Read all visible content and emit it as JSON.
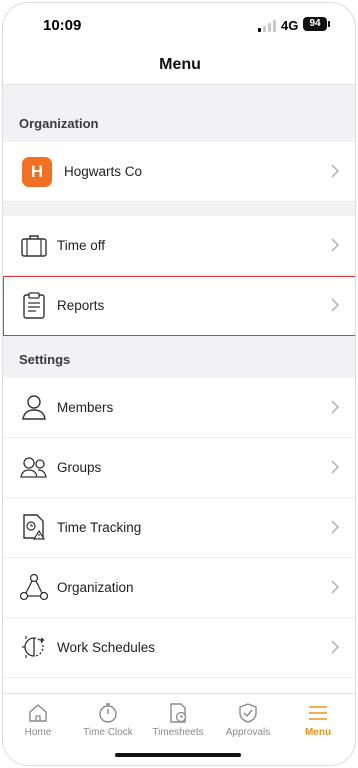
{
  "status_bar": {
    "time": "10:09",
    "network": "4G",
    "battery": "94"
  },
  "header": {
    "title": "Menu"
  },
  "organization_section": {
    "label": "Organization",
    "org": {
      "initial": "H",
      "name": "Hogwarts Co",
      "color": "#f36f21"
    }
  },
  "menu_items": [
    {
      "label": "Time off",
      "icon": "briefcase-icon"
    },
    {
      "label": "Reports",
      "icon": "clipboard-icon",
      "highlighted": true
    }
  ],
  "settings_section": {
    "label": "Settings",
    "items": [
      {
        "label": "Members",
        "icon": "person-icon"
      },
      {
        "label": "Groups",
        "icon": "people-icon"
      },
      {
        "label": "Time Tracking",
        "icon": "time-document-icon"
      },
      {
        "label": "Organization",
        "icon": "network-icon"
      },
      {
        "label": "Work Schedules",
        "icon": "day-night-icon"
      }
    ]
  },
  "tabbar": {
    "accent": "#f0921c",
    "tabs": [
      {
        "label": "Home",
        "icon": "home-icon"
      },
      {
        "label": "Time Clock",
        "icon": "stopwatch-icon"
      },
      {
        "label": "Timesheets",
        "icon": "timesheet-icon"
      },
      {
        "label": "Approvals",
        "icon": "shield-check-icon"
      },
      {
        "label": "Menu",
        "icon": "hamburger-icon",
        "active": true
      }
    ]
  }
}
